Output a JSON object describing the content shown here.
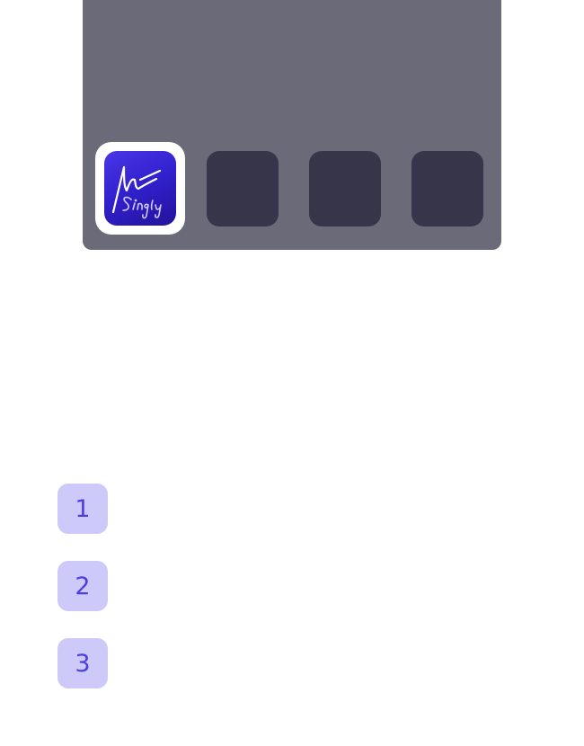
{
  "dock": {
    "apps": [
      {
        "name": "Singly",
        "selected": true,
        "icon": "signature-logo-icon"
      },
      {
        "name": "",
        "selected": false,
        "icon": "empty-app-slot"
      },
      {
        "name": "",
        "selected": false,
        "icon": "empty-app-slot"
      },
      {
        "name": "",
        "selected": false,
        "icon": "empty-app-slot"
      }
    ],
    "colors": {
      "panel": "#6b6a79",
      "slot": "#36354a",
      "icon_gradient_start": "#4a36e8",
      "icon_gradient_end": "#22139a"
    }
  },
  "steps": [
    {
      "number": "1"
    },
    {
      "number": "2"
    },
    {
      "number": "3"
    }
  ],
  "colors": {
    "step_badge_bg": "#cdcaf9",
    "step_badge_text": "#4b3fe4"
  }
}
